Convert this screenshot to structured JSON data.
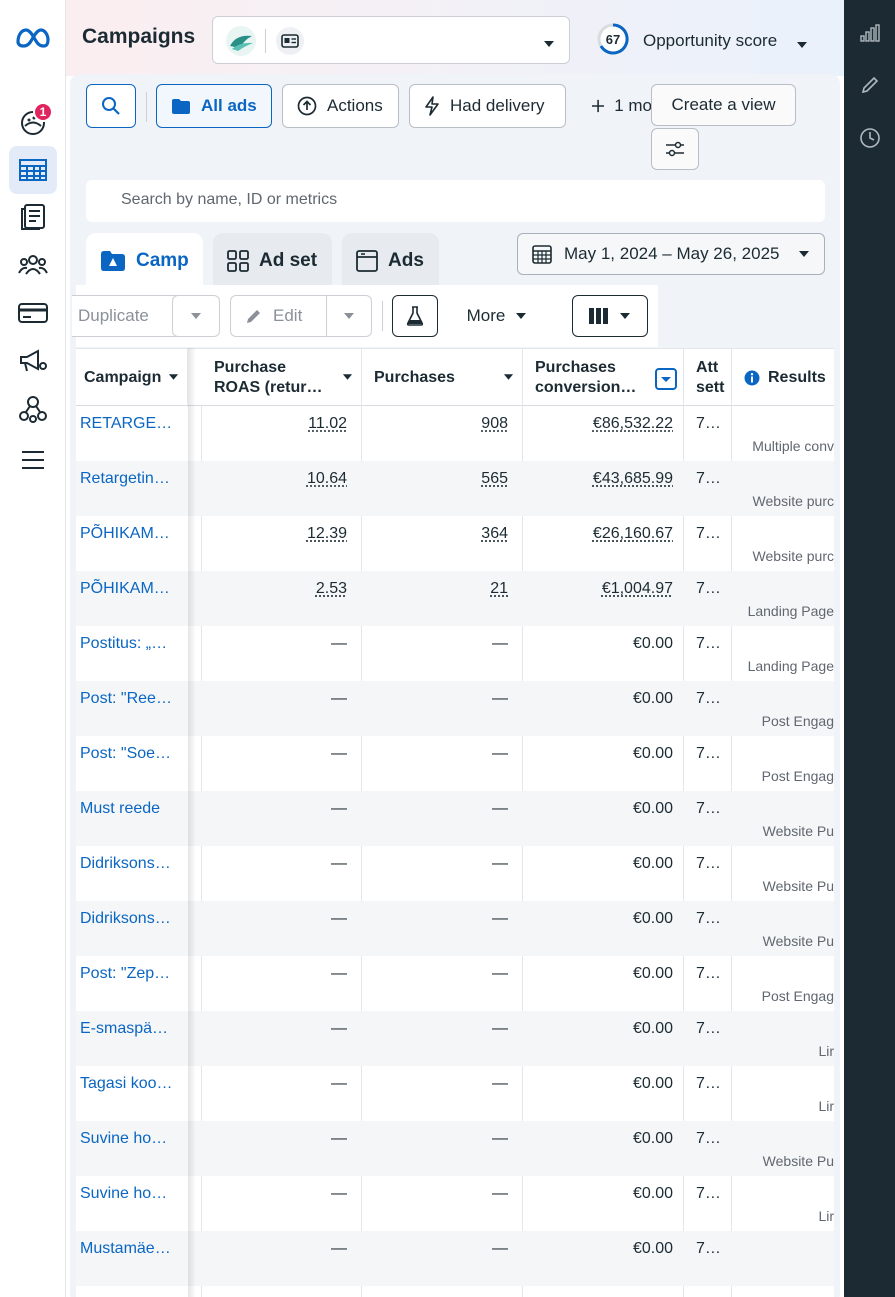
{
  "header": {
    "title": "Campaigns",
    "opportunity_score": "67",
    "opportunity_label": "Opportunity score"
  },
  "leftnav": {
    "notification_count": "1"
  },
  "toolbar": {
    "all_ads_label": "All ads",
    "actions_label": "Actions",
    "had_delivery_label": "Had delivery",
    "more_filters_label": "1 mo",
    "create_view_label": "Create a view"
  },
  "search": {
    "placeholder": "Search by name, ID or metrics"
  },
  "tabs": {
    "campaigns_label": "Camp",
    "adsets_label": "Ad set",
    "ads_label": "Ads"
  },
  "date_range": "May 1, 2024 – May 26, 2025",
  "actionbar": {
    "duplicate_label": "Duplicate",
    "edit_label": "Edit",
    "more_label": "More"
  },
  "table": {
    "columns": {
      "campaign": "Campaign",
      "roas_line1": "Purchase",
      "roas_line2": "ROAS (retur…",
      "purchases": "Purchases",
      "conv_line1": "Purchases",
      "conv_line2": "conversion…",
      "attr_line1": "Att",
      "attr_line2": "sett",
      "results": "Results"
    },
    "rows": [
      {
        "name": "RETARGE…",
        "roas": "11.02",
        "purchases": "908",
        "conversion": "€86,532.22",
        "attr": "7…",
        "result": "Multiple conv"
      },
      {
        "name": "Retargetin…",
        "roas": "10.64",
        "purchases": "565",
        "conversion": "€43,685.99",
        "attr": "7…",
        "result": "Website purc"
      },
      {
        "name": "PÕHIKAM…",
        "roas": "12.39",
        "purchases": "364",
        "conversion": "€26,160.67",
        "attr": "7…",
        "result": "Website purc"
      },
      {
        "name": "PÕHIKAM…",
        "roas": "2.53",
        "purchases": "21",
        "conversion": "€1,004.97",
        "attr": "7…",
        "result": "Landing Page"
      },
      {
        "name": "Postitus: „…",
        "roas": "—",
        "purchases": "—",
        "conversion": "€0.00",
        "attr": "7…",
        "result": "Landing Page"
      },
      {
        "name": "Post: \"Ree…",
        "roas": "—",
        "purchases": "—",
        "conversion": "€0.00",
        "attr": "7…",
        "result": "Post Engag"
      },
      {
        "name": "Post: \"Soe…",
        "roas": "—",
        "purchases": "—",
        "conversion": "€0.00",
        "attr": "7…",
        "result": "Post Engag"
      },
      {
        "name": "Must reede",
        "roas": "—",
        "purchases": "—",
        "conversion": "€0.00",
        "attr": "7…",
        "result": "Website Pu"
      },
      {
        "name": "Didriksons…",
        "roas": "—",
        "purchases": "—",
        "conversion": "€0.00",
        "attr": "7…",
        "result": "Website Pu"
      },
      {
        "name": "Didriksons…",
        "roas": "—",
        "purchases": "—",
        "conversion": "€0.00",
        "attr": "7…",
        "result": "Website Pu"
      },
      {
        "name": "Post: \"Zep…",
        "roas": "—",
        "purchases": "—",
        "conversion": "€0.00",
        "attr": "7…",
        "result": "Post Engag"
      },
      {
        "name": "E-smaspä…",
        "roas": "—",
        "purchases": "—",
        "conversion": "€0.00",
        "attr": "7…",
        "result": "Lir"
      },
      {
        "name": "Tagasi koo…",
        "roas": "—",
        "purchases": "—",
        "conversion": "€0.00",
        "attr": "7…",
        "result": "Lir"
      },
      {
        "name": "Suvine ho…",
        "roas": "—",
        "purchases": "—",
        "conversion": "€0.00",
        "attr": "7…",
        "result": "Website Pu"
      },
      {
        "name": "Suvine ho…",
        "roas": "—",
        "purchases": "—",
        "conversion": "€0.00",
        "attr": "7…",
        "result": "Lir"
      },
      {
        "name": "Mustamäe…",
        "roas": "—",
        "purchases": "—",
        "conversion": "€0.00",
        "attr": "7…",
        "result": ""
      }
    ]
  },
  "colors": {
    "accent": "#0a66c2",
    "text": "#1c2b33",
    "rail": "#1c2b33",
    "badge": "#e0245e"
  }
}
